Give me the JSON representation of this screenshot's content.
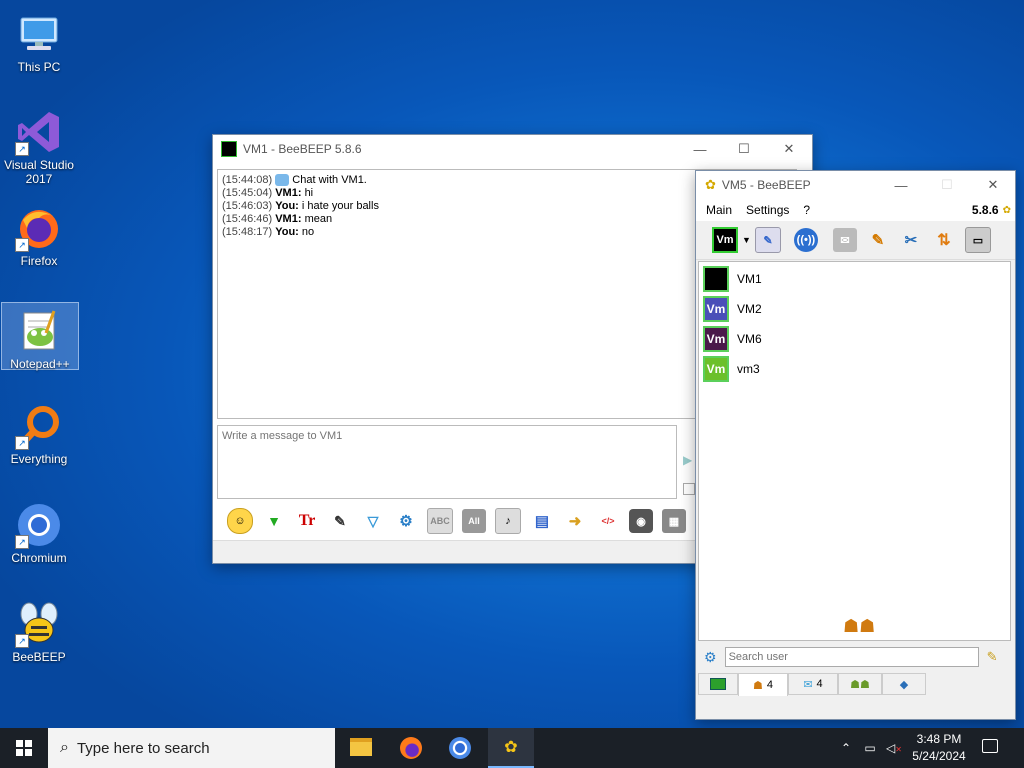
{
  "desktop": {
    "icons": [
      {
        "label": "This PC"
      },
      {
        "label": "Visual Studio 2017"
      },
      {
        "label": "Firefox"
      },
      {
        "label": "Notepad++"
      },
      {
        "label": "Everything"
      },
      {
        "label": "Chromium"
      },
      {
        "label": "BeeBEEP"
      }
    ]
  },
  "chat_window": {
    "title": "VM1 - BeeBEEP 5.8.6",
    "messages": [
      {
        "time": "(15:44:08)",
        "sender": "",
        "text": "Chat with VM1."
      },
      {
        "time": "(15:45:04)",
        "sender": "VM1:",
        "text": "hi"
      },
      {
        "time": "(15:46:03)",
        "sender": "You:",
        "text": "i hate your balls"
      },
      {
        "time": "(15:46:46)",
        "sender": "VM1:",
        "text": "mean"
      },
      {
        "time": "(15:48:17)",
        "sender": "You:",
        "text": "no"
      }
    ],
    "input_placeholder": "Write a message to VM1"
  },
  "main_window": {
    "title": "VM5 - BeeBEEP",
    "menu": [
      "Main",
      "Settings",
      "?"
    ],
    "version": "5.8.6",
    "status_avatar": "Vm",
    "users": [
      {
        "name": "VM1",
        "avatar": "",
        "color": "#000000"
      },
      {
        "name": "VM2",
        "avatar": "Vm",
        "color": "#4a4fb8"
      },
      {
        "name": "VM6",
        "avatar": "Vm",
        "color": "#4a1a4a"
      },
      {
        "name": "vm3",
        "avatar": "Vm",
        "color": "#6cc02a"
      }
    ],
    "search_placeholder": "Search user",
    "tabs": [
      {
        "label": ""
      },
      {
        "label": "4"
      },
      {
        "label": "4"
      },
      {
        "label": ""
      },
      {
        "label": ""
      }
    ]
  },
  "taskbar": {
    "search_placeholder": "Type here to search",
    "time": "3:48 PM",
    "date": "5/24/2024"
  }
}
